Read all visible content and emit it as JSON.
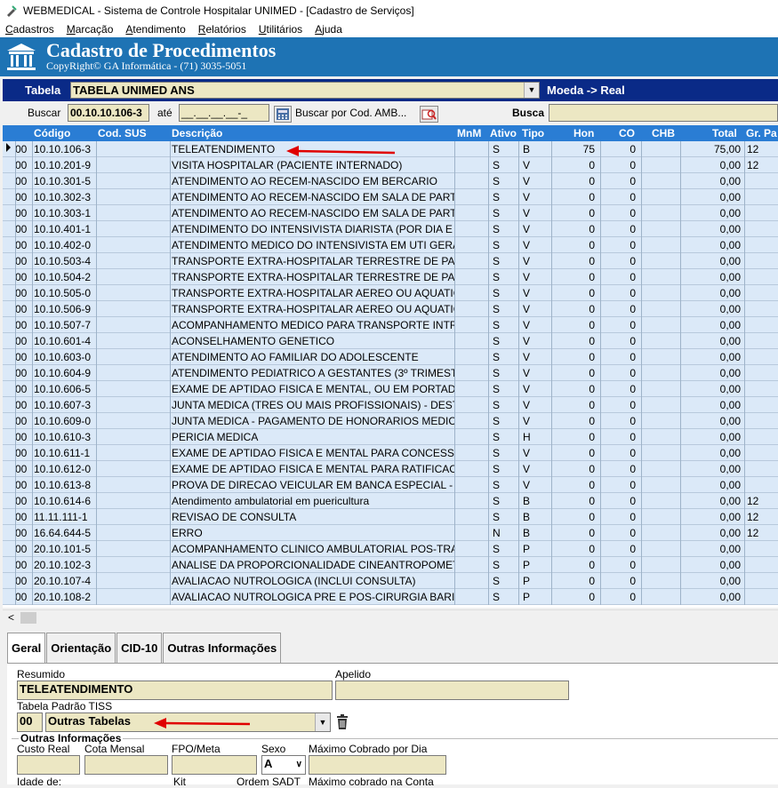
{
  "window": {
    "title": "WEBMEDICAL - Sistema de Controle Hospitalar UNIMED - [Cadastro de Serviços]"
  },
  "menu": [
    "Cadastros",
    "Marcação",
    "Atendimento",
    "Relatórios",
    "Utilitários",
    "Ajuda"
  ],
  "banner": {
    "title": "Cadastro de Procedimentos",
    "subtitle": "CopyRight© GA Informática - (71) 3035-5051"
  },
  "tablebar": {
    "label": "Tabela",
    "value": "TABELA UNIMED ANS",
    "moeda": "Moeda -> Real"
  },
  "search": {
    "buscar_label": "Buscar",
    "from": "00.10.10.106-3",
    "ate_label": "até",
    "to": "__.__.__.__-_",
    "button_label": "Buscar por Cod. AMB...",
    "busca_label": "Busca",
    "busca_value": ""
  },
  "grid": {
    "columns": [
      "Código",
      "Cod. SUS",
      "Descrição",
      "MnM",
      "Ativo",
      "Tipo",
      "Hon",
      "CO",
      "CHB",
      "Total",
      "Gr. Pa"
    ],
    "rows": [
      [
        "00",
        "10.10.106-3",
        "",
        "TELEATENDIMENTO",
        "S",
        "B",
        "75",
        "0",
        "75,00",
        "12"
      ],
      [
        "00",
        "10.10.201-9",
        "",
        "VISITA HOSPITALAR (PACIENTE INTERNADO)",
        "S",
        "V",
        "0",
        "0",
        "0,00",
        "12"
      ],
      [
        "00",
        "10.10.301-5",
        "",
        "ATENDIMENTO AO RECEM-NASCIDO EM BERCARIO",
        "S",
        "V",
        "0",
        "0",
        "0,00",
        ""
      ],
      [
        "00",
        "10.10.302-3",
        "",
        "ATENDIMENTO AO RECEM-NASCIDO EM SALA DE PARTO",
        "S",
        "V",
        "0",
        "0",
        "0,00",
        ""
      ],
      [
        "00",
        "10.10.303-1",
        "",
        "ATENDIMENTO AO RECEM-NASCIDO EM SALA DE PARTO",
        "S",
        "V",
        "0",
        "0",
        "0,00",
        ""
      ],
      [
        "00",
        "10.10.401-1",
        "",
        "ATENDIMENTO DO INTENSIVISTA DIARISTA (POR DIA E P",
        "S",
        "V",
        "0",
        "0",
        "0,00",
        ""
      ],
      [
        "00",
        "10.10.402-0",
        "",
        "ATENDIMENTO MEDICO DO INTENSIVISTA EM UTI GERA",
        "S",
        "V",
        "0",
        "0",
        "0,00",
        ""
      ],
      [
        "00",
        "10.10.503-4",
        "",
        "TRANSPORTE EXTRA-HOSPITALAR TERRESTRE DE PAC",
        "S",
        "V",
        "0",
        "0",
        "0,00",
        ""
      ],
      [
        "00",
        "10.10.504-2",
        "",
        "TRANSPORTE EXTRA-HOSPITALAR TERRESTRE DE PAC",
        "S",
        "V",
        "0",
        "0",
        "0,00",
        ""
      ],
      [
        "00",
        "10.10.505-0",
        "",
        "TRANSPORTE EXTRA-HOSPITALAR AEREO OU AQUATIC",
        "S",
        "V",
        "0",
        "0",
        "0,00",
        ""
      ],
      [
        "00",
        "10.10.506-9",
        "",
        "TRANSPORTE EXTRA-HOSPITALAR AEREO OU AQUATIC",
        "S",
        "V",
        "0",
        "0",
        "0,00",
        ""
      ],
      [
        "00",
        "10.10.507-7",
        "",
        "ACOMPANHAMENTO MEDICO PARA TRANSPORTE INTRA",
        "S",
        "V",
        "0",
        "0",
        "0,00",
        ""
      ],
      [
        "00",
        "10.10.601-4",
        "",
        "ACONSELHAMENTO GENETICO",
        "S",
        "V",
        "0",
        "0",
        "0,00",
        ""
      ],
      [
        "00",
        "10.10.603-0",
        "",
        "ATENDIMENTO AO FAMILIAR DO ADOLESCENTE",
        "S",
        "V",
        "0",
        "0",
        "0,00",
        ""
      ],
      [
        "00",
        "10.10.604-9",
        "",
        "ATENDIMENTO PEDIATRICO A GESTANTES (3º TRIMEST",
        "S",
        "V",
        "0",
        "0",
        "0,00",
        ""
      ],
      [
        "00",
        "10.10.606-5",
        "",
        "EXAME DE APTIDAO FISICA E MENTAL, OU EM PORTADO",
        "S",
        "V",
        "0",
        "0",
        "0,00",
        ""
      ],
      [
        "00",
        "10.10.607-3",
        "",
        "JUNTA MEDICA (TRES OU MAIS PROFISSIONAIS) - DEST",
        "S",
        "V",
        "0",
        "0",
        "0,00",
        ""
      ],
      [
        "00",
        "10.10.609-0",
        "",
        "JUNTA MEDICA - PAGAMENTO DE HONORARIOS MEDICO",
        "S",
        "V",
        "0",
        "0",
        "0,00",
        ""
      ],
      [
        "00",
        "10.10.610-3",
        "",
        "PERICIA MEDICA",
        "S",
        "H",
        "0",
        "0",
        "0,00",
        ""
      ],
      [
        "00",
        "10.10.611-1",
        "",
        "EXAME DE APTIDAO FISICA E MENTAL PARA CONCESSA",
        "S",
        "V",
        "0",
        "0",
        "0,00",
        ""
      ],
      [
        "00",
        "10.10.612-0",
        "",
        "EXAME DE APTIDAO FISICA E MENTAL PARA RATIFICACA",
        "S",
        "V",
        "0",
        "0",
        "0,00",
        ""
      ],
      [
        "00",
        "10.10.613-8",
        "",
        "PROVA DE DIRECAO VEICULAR EM BANCA ESPECIAL - A",
        "S",
        "V",
        "0",
        "0",
        "0,00",
        ""
      ],
      [
        "00",
        "10.10.614-6",
        "",
        "Atendimento ambulatorial em puericultura",
        "S",
        "B",
        "0",
        "0",
        "0,00",
        "12"
      ],
      [
        "00",
        "11.11.111-1",
        "",
        "REVISAO DE CONSULTA",
        "S",
        "B",
        "0",
        "0",
        "0,00",
        "12"
      ],
      [
        "00",
        "16.64.644-5",
        "",
        "ERRO",
        "N",
        "B",
        "0",
        "0",
        "0,00",
        "12"
      ],
      [
        "00",
        "20.10.101-5",
        "",
        "ACOMPANHAMENTO CLINICO AMBULATORIAL POS-TRAN",
        "S",
        "P",
        "0",
        "0",
        "0,00",
        ""
      ],
      [
        "00",
        "20.10.102-3",
        "",
        "ANALISE DA PROPORCIONALIDADE CINEANTROPOMET",
        "S",
        "P",
        "0",
        "0",
        "0,00",
        ""
      ],
      [
        "00",
        "20.10.107-4",
        "",
        "AVALIACAO NUTROLOGICA (INCLUI CONSULTA)",
        "S",
        "P",
        "0",
        "0",
        "0,00",
        ""
      ],
      [
        "00",
        "20.10.108-2",
        "",
        "AVALIACAO NUTROLOGICA PRE E POS-CIRURGIA BARIA",
        "S",
        "P",
        "0",
        "0",
        "0,00",
        ""
      ]
    ]
  },
  "tabs": [
    "Geral",
    "Orientação",
    "CID-10",
    "Outras Informações"
  ],
  "form": {
    "resumido_label": "Resumido",
    "resumido_value": "TELEATENDIMENTO",
    "apelido_label": "Apelido",
    "apelido_value": "",
    "tiss_label": "Tabela Padrão TISS",
    "tiss_code": "00",
    "tiss_value": "Outras Tabelas",
    "outras_label": "Outras Informações",
    "custo_label": "Custo Real",
    "cota_label": "Cota Mensal",
    "fpo_label": "FPO/Meta",
    "sexo_label": "Sexo",
    "sexo_value": "A",
    "maximo_dia_label": "Máximo Cobrado por Dia",
    "idade_label": "Idade de:",
    "kit_label": "Kit",
    "ordem_label": "Ordem SADT",
    "maximo_conta_label": "Máximo cobrado na Conta"
  },
  "colors": {
    "banner": "#1e73b4",
    "tablebar": "#0a2a87",
    "grid_header": "#2a7dd4",
    "grid_row": "#dbe9f8",
    "field": "#ece7c3",
    "arrow": "#e00000"
  }
}
